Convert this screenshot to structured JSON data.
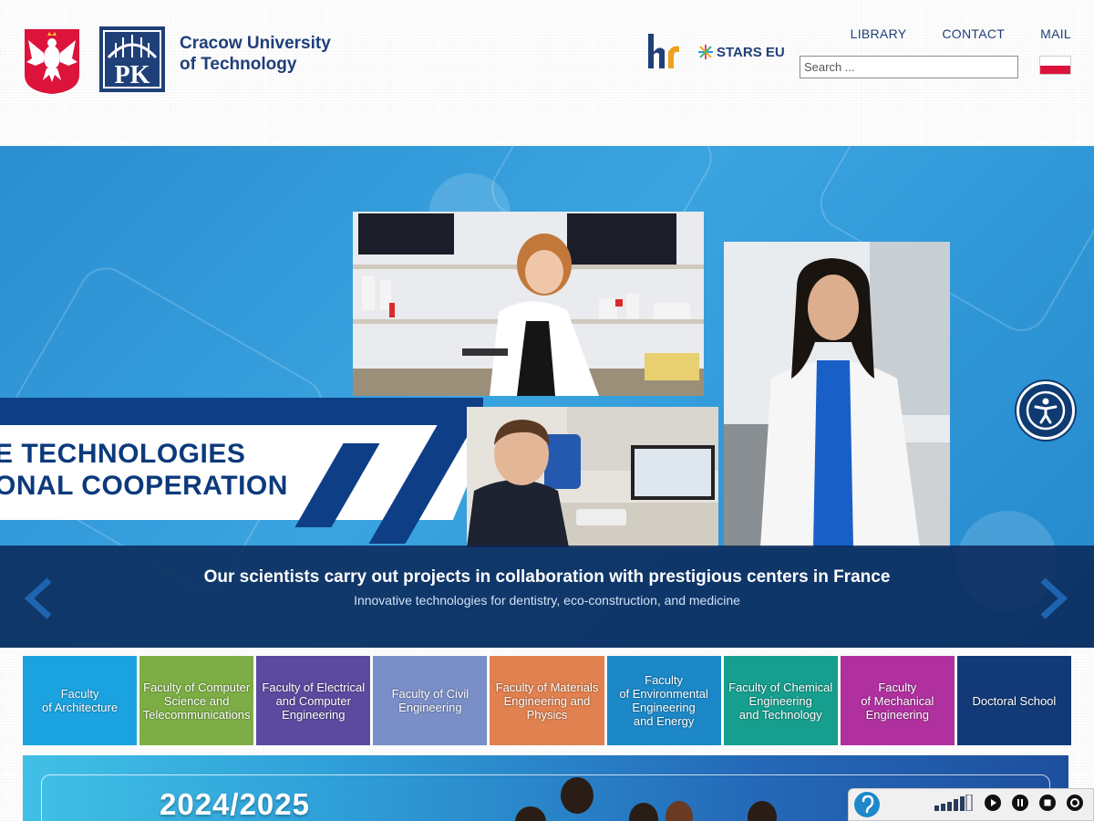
{
  "header": {
    "university_name_line1": "Cracow University",
    "university_name_line2": "of Technology",
    "stars_label": "STARS EU",
    "nav": [
      {
        "label": "LIBRARY"
      },
      {
        "label": "CONTACT"
      },
      {
        "label": "MAIL"
      }
    ],
    "search": {
      "placeholder": "Search ..."
    },
    "language_flag": "pl-flag-icon"
  },
  "hero": {
    "banner_line1": "E TECHNOLOGIES",
    "banner_line2": "ONAL COOPERATION",
    "caption_title": "Our scientists carry out projects in collaboration with prestigious centers in France",
    "caption_subtitle": "Innovative technologies for dentistry, eco-construction, and medicine",
    "colors": {
      "primary_blue": "#2a8ed0",
      "dark_navy": "#0e3f86"
    }
  },
  "faculties": [
    {
      "label": "Faculty\nof Architecture",
      "color": "#1aa3e0"
    },
    {
      "label": "Faculty of Computer\nScience and\nTelecommunications",
      "color": "#7cae45"
    },
    {
      "label": "Faculty of Electrical\nand Computer\nEngineering",
      "color": "#5b4a9f"
    },
    {
      "label": "Faculty of Civil\nEngineering",
      "color": "#7a8fc8"
    },
    {
      "label": "Faculty of Materials\nEngineering and\nPhysics",
      "color": "#e0814f"
    },
    {
      "label": "Faculty\nof Environmental\nEngineering\nand Energy",
      "color": "#1c88c8"
    },
    {
      "label": "Faculty of Chemical\nEngineering\nand Technology",
      "color": "#169f8e"
    },
    {
      "label": "Faculty\nof Mechanical\nEngineering",
      "color": "#b030a0"
    },
    {
      "label": "Doctoral School",
      "color": "#123a78"
    }
  ],
  "lower_banner": {
    "year": "2024/2025"
  }
}
